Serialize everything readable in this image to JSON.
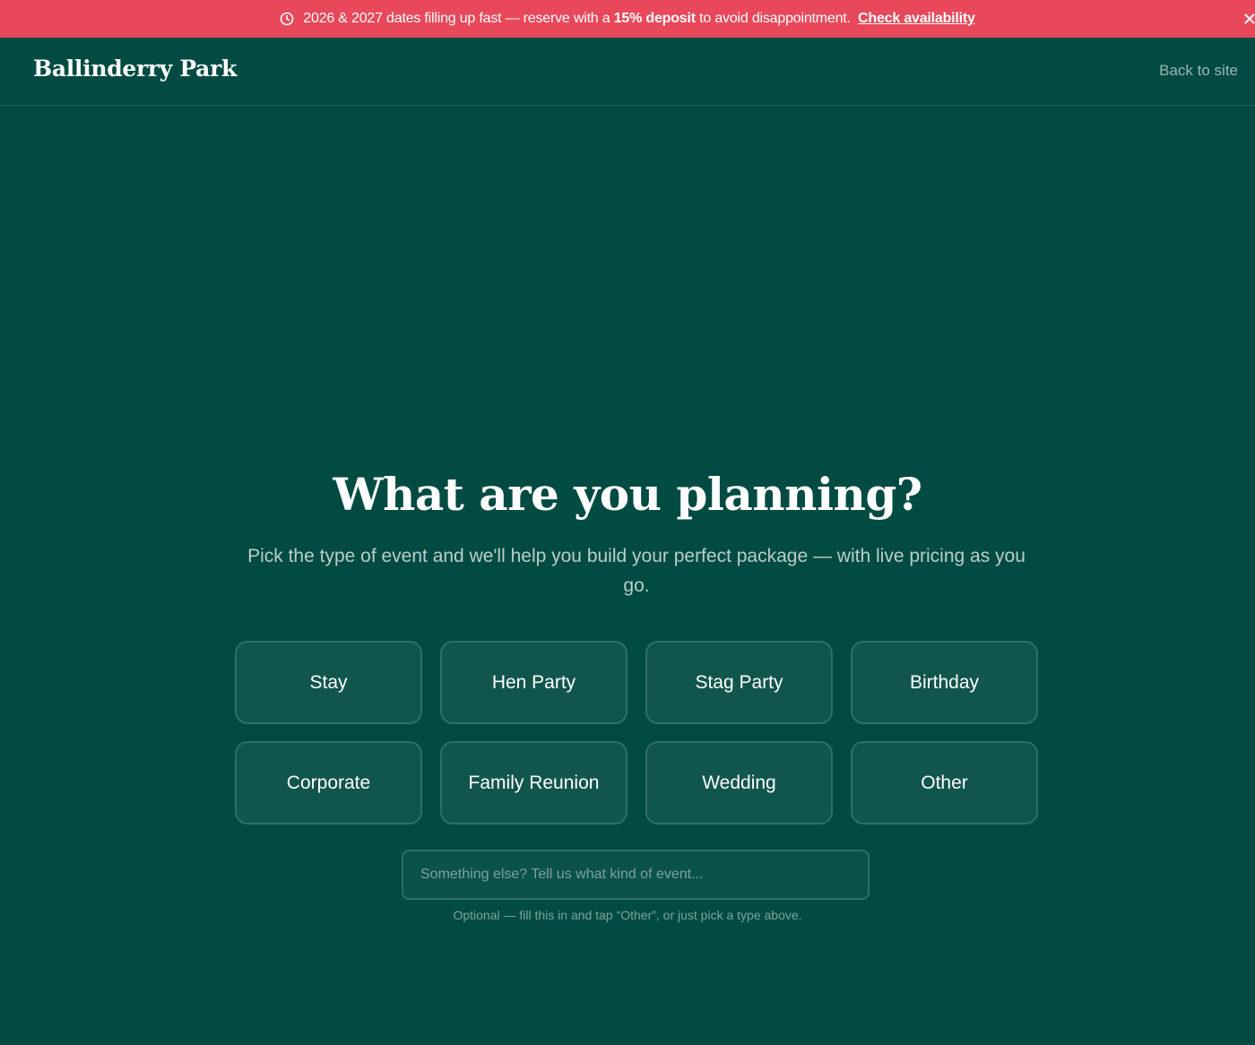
{
  "announcement": {
    "text_before": "2026 & 2027 dates filling up fast — reserve with a",
    "highlight": "15% deposit",
    "text_after": "to avoid disappointment.",
    "link_label": "Check availability",
    "close_glyph": "×",
    "icons": {
      "leading": "clock-icon",
      "close": "close-icon"
    },
    "background_color": "#e8485a"
  },
  "header": {
    "brand": "Ballinderry Park",
    "back_link": "Back to site"
  },
  "main": {
    "title": "What are you planning?",
    "subtitle": "Pick the type of event and we'll help you build your perfect package — with live pricing as you go.",
    "event_types": [
      {
        "label": "Stay"
      },
      {
        "label": "Hen Party"
      },
      {
        "label": "Stag Party"
      },
      {
        "label": "Birthday"
      },
      {
        "label": "Corporate"
      },
      {
        "label": "Family Reunion"
      },
      {
        "label": "Wedding"
      },
      {
        "label": "Other"
      }
    ],
    "other_input": {
      "value": "",
      "placeholder": "Something else? Tell us what kind of event..."
    },
    "hint": "Optional — fill this in and tap “Other”, or just pick a type above."
  },
  "colors": {
    "background": "#024b42",
    "card": "#11564d",
    "card_border": "#2e6f66",
    "accent": "#e8485a"
  }
}
